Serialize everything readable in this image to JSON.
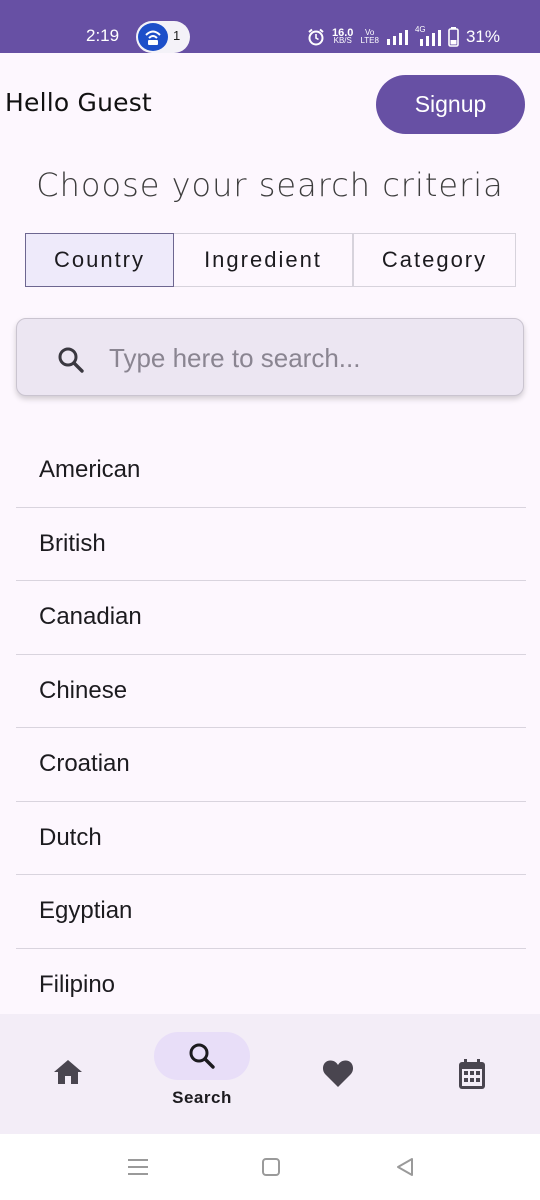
{
  "status_bar": {
    "time": "2:19",
    "hotspot_count": "1",
    "net_speed_top": "16.0",
    "net_speed_bottom": "KB/S",
    "volte_top": "Vo",
    "volte_bottom": "LTE8",
    "network_type": "4G",
    "battery": "31%"
  },
  "header": {
    "greeting": "Hello Guest",
    "signup_label": "Signup"
  },
  "criteria": {
    "title": "Choose your search criteria",
    "options": [
      "Country",
      "Ingredient",
      "Category"
    ],
    "selected": "Country"
  },
  "search": {
    "placeholder": "Type here to search...",
    "value": ""
  },
  "countries": [
    "American",
    "British",
    "Canadian",
    "Chinese",
    "Croatian",
    "Dutch",
    "Egyptian",
    "Filipino"
  ],
  "bottom_nav": {
    "items": [
      "home-icon",
      "search-icon",
      "heart-icon",
      "calendar-icon"
    ],
    "active_label": "Search"
  },
  "colors": {
    "primary": "#6750a4",
    "background": "#fdf7fe",
    "nav_background": "#f3edf7",
    "active_indicator": "#e8def8"
  }
}
